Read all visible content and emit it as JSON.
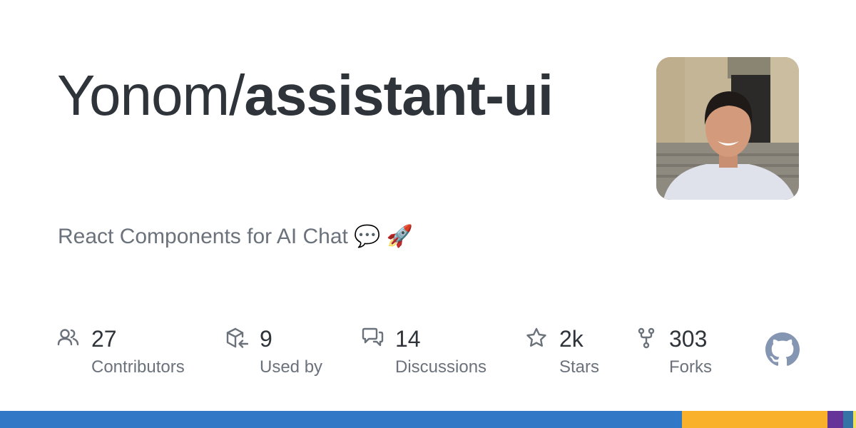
{
  "repo": {
    "owner": "Yonom/",
    "name": "assistant-ui",
    "description": "React Components for AI Chat 💬 🚀"
  },
  "stats": [
    {
      "icon": "people-icon",
      "value": "27",
      "label": "Contributors"
    },
    {
      "icon": "package-dependents-icon",
      "value": "9",
      "label": "Used by"
    },
    {
      "icon": "discussions-icon",
      "value": "14",
      "label": "Discussions"
    },
    {
      "icon": "star-icon",
      "value": "2k",
      "label": "Stars"
    },
    {
      "icon": "repo-forked-icon",
      "value": "303",
      "label": "Forks"
    }
  ],
  "colors": {
    "text_primary": "#2f343a",
    "text_secondary": "#6b727b",
    "icon": "#6b727b",
    "github_mark": "#8596b3"
  },
  "language_bar": [
    {
      "color": "#3178c6",
      "percent": 79.7
    },
    {
      "color": "#f9b12b",
      "percent": 17.0
    },
    {
      "color": "#663399",
      "percent": 1.8
    },
    {
      "color": "#3572a5",
      "percent": 1.2
    },
    {
      "color": "#f1e05a",
      "percent": 0.3
    }
  ]
}
